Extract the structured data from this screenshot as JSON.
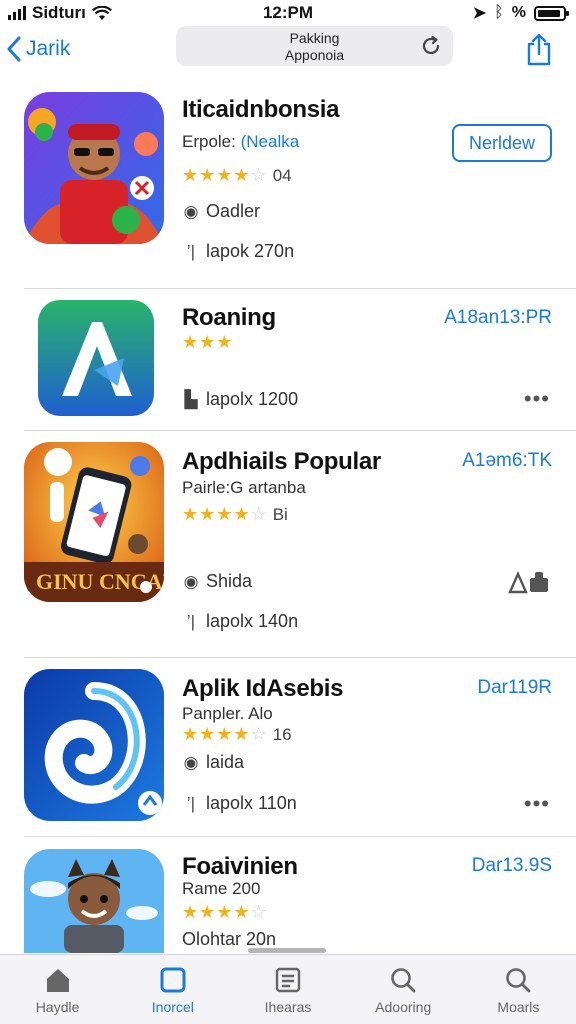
{
  "status_bar": {
    "carrier": "Sidturı",
    "time": "12:PM",
    "battery": "%"
  },
  "nav": {
    "back_label": "Jarik",
    "address_line1": "Pakking",
    "address_line2": "Apponoia"
  },
  "apps": [
    {
      "name": "Iticaidnbonsia",
      "subtitle_prefix": "Erpole:",
      "subtitle_highlight": "(Nealka",
      "stars_filled": 4,
      "stars_total": 5,
      "rating_count": "04",
      "meta1_icon": "clock-icon",
      "meta1": "Oadler",
      "meta2_icon": "tag-icon",
      "meta2": "lapok 270n",
      "action": "Nerldew",
      "icon_colors": {
        "bg1": "#6a3dd6",
        "bg2": "#2f6ce8",
        "accent": "#d8222a",
        "green": "#2bb24a"
      }
    },
    {
      "name": "Roaning",
      "stars_filled": 3,
      "stars_total": 3,
      "meta2_icon": "bag-icon",
      "meta2": "lapolx 1200",
      "price": "A18an13:PR",
      "more": "•••",
      "icon_colors": {
        "bg1": "#29b46a",
        "bg2": "#1f5fd0",
        "letter": "#ffffff"
      },
      "icon_letter": "A"
    },
    {
      "name": "Apdhiails Popular",
      "subtitle_prefix": "Pairle:G artanba",
      "stars_filled": 4,
      "stars_total": 5,
      "rating_count": "Bi",
      "meta1_icon": "clock-icon",
      "meta1": "Shida",
      "meta2_icon": "tag-icon",
      "meta2": "lapolx 140n",
      "price": "A1əm6:TK",
      "icon_colors": {
        "bg1": "#f2a321",
        "bg2": "#d85b14",
        "phone": "#1f2430"
      },
      "icon_text": "GINU CNCAE"
    },
    {
      "name": "Aplik IdAsebis",
      "subtitle_prefix": "Panpler. Alo",
      "stars_filled": 4,
      "stars_total": 5,
      "rating_count": "16",
      "meta1_icon": "clock-icon",
      "meta1": "laida",
      "meta2_icon": "tag-icon",
      "meta2": "lapolx 110n",
      "price": "Dar119R",
      "more": "•••",
      "icon_colors": {
        "bg1": "#0b3aa8",
        "bg2": "#1d7ae0",
        "swirl": "#ffffff"
      }
    },
    {
      "name": "Foaivinien",
      "subtitle_prefix": "Rame 200",
      "stars_filled": 4,
      "stars_total": 5,
      "meta2": "Olohtar 20n",
      "price": "Dar13.9S",
      "icon_colors": {
        "sky": "#5fb4f2",
        "skin": "#8a5a3c"
      }
    }
  ],
  "tabs": [
    {
      "label": "Haydle",
      "icon": "home-icon",
      "active": false
    },
    {
      "label": "Inorcel",
      "icon": "square-icon",
      "active": true
    },
    {
      "label": "Ihearas",
      "icon": "list-icon",
      "active": false
    },
    {
      "label": "Adooring",
      "icon": "search-icon",
      "active": false
    },
    {
      "label": "Moarls",
      "icon": "search-icon",
      "active": false
    }
  ],
  "colors": {
    "accent": "#1a7ad9",
    "star": "#f3b21c",
    "divider": "#d9d9de"
  }
}
